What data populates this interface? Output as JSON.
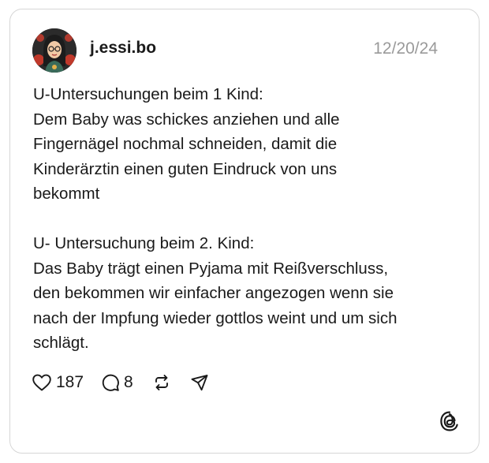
{
  "post": {
    "username": "j.essi.bo",
    "date": "12/20/24",
    "lines_part1": [
      "U-Untersuchungen beim 1 Kind:",
      "Dem Baby was schickes anziehen und alle",
      "Fingernägel nochmal schneiden, damit die",
      "Kinderärztin einen guten Eindruck von uns",
      "bekommt"
    ],
    "lines_part2": [
      "U- Untersuchung beim 2. Kind:",
      "Das Baby trägt einen Pyjama mit Reißverschluss,",
      "den bekommen wir einfacher angezogen wenn sie",
      "nach der Impfung wieder gottlos weint und um sich",
      "schlägt."
    ]
  },
  "actions": {
    "likes": "187",
    "replies": "8"
  },
  "icons": {
    "like": "heart-icon",
    "reply": "speech-bubble-icon",
    "repost": "repost-icon",
    "share": "send-icon",
    "brand": "threads-logo-icon"
  },
  "colors": {
    "text": "#1a1a1a",
    "muted": "#9a9a9a",
    "border": "#d6d6d6"
  }
}
